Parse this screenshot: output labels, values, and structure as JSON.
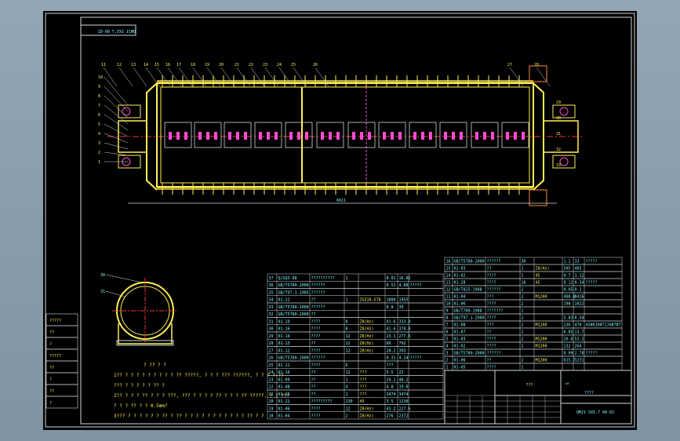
{
  "drawing": {
    "code": "QMJ1 SX5.7 00-02",
    "code_mirrored": "QMJ1 SX5.7 00-02",
    "title_block_label": "????",
    "title_block_cell": "???",
    "overall_dim": "6611"
  },
  "left_strip": [
    "?????",
    "??",
    "?",
    "?????",
    "??",
    "?",
    "??",
    "?"
  ],
  "notes": {
    "heading": "? ?? ? ?",
    "lines": [
      "1?? ? ? ? ? ? ? ? ? ? ?? ?????, ? ? ? ??? ??????, ? ? ? ? ??",
      "??? ? ? ? ? ? ?? ?",
      "2?? ? ? ? ?? ? ? ? ???, ??? ? ? ? ? ?? ? ? ? ?? ?????, ? ? ???",
      "? ? ? ?? ? ? 0.5mm?",
      "3??? ? ? ? ? ? ? ?? ? ?? ? ? ? ? ? ? ? ? ? ? ? ?? ? ?"
    ]
  },
  "parts_left": [
    [
      "37",
      "Q/GQ3-08",
      "??????????",
      "2",
      "",
      "8.01",
      "16.02",
      ""
    ],
    [
      "36",
      "GB/T5780-2000",
      "??????",
      "",
      "",
      "0.51",
      "4.80",
      "?????"
    ],
    [
      "35",
      "GB/T97.1-1985",
      "??????",
      "",
      "",
      "",
      "",
      ""
    ],
    [
      "34",
      "01-22",
      "??",
      "1",
      "ZG310-570",
      "1800",
      "1955",
      ""
    ],
    [
      "33",
      "GB/T5780-2000",
      "??????",
      "",
      "",
      "0.8",
      "39",
      ""
    ],
    [
      "32",
      "GB/T5780-2000",
      "??",
      "",
      "",
      "",
      "",
      ""
    ],
    [
      "31",
      "01-19",
      "????",
      "8",
      "Z8(Hz)",
      "41.6",
      "333.8",
      ""
    ],
    [
      "30",
      "01-16",
      "????",
      "8",
      "Z8(Hz)",
      "41.6",
      "378.8",
      ""
    ],
    [
      "29",
      "01-14",
      "????",
      "12",
      "Z8(Hz)",
      "23.1",
      "277.6",
      ""
    ],
    [
      "28",
      "01-13",
      "??",
      "12",
      "Z8(Hz)",
      "66",
      "792",
      ""
    ],
    [
      "27",
      "01-12",
      "????",
      "12",
      "Z8(Hz)",
      "28.2",
      "393",
      ""
    ],
    [
      "26",
      "GB/T5780-2000",
      "??????",
      "",
      "",
      "0.31",
      "4.24",
      "?????"
    ],
    [
      "25",
      "01-11",
      "????",
      "6",
      "",
      "???",
      "",
      ""
    ],
    [
      "24",
      "01-10",
      "??",
      "12",
      "???",
      "5.5",
      "22",
      ""
    ],
    [
      "23",
      "01-09",
      "??",
      "1",
      "???",
      "24.1",
      "48.2",
      ""
    ],
    [
      "22",
      "01-08",
      "??",
      "4",
      "???",
      "4.8",
      "19.6",
      ""
    ],
    [
      "21",
      "01-15",
      "??",
      "1",
      "???",
      "3474",
      "3474",
      ""
    ],
    [
      "20",
      "01-22",
      "?????????",
      "230",
      "45",
      "3.5",
      "1230",
      ""
    ],
    [
      "19",
      "01-06",
      "????",
      "12",
      "Z8(Hz)",
      "43.2",
      "227.6",
      ""
    ],
    [
      "18",
      "01-04",
      "????",
      "2",
      "Z8(Hz)",
      "276",
      "2372",
      ""
    ]
  ],
  "parts_right": [
    [
      "16",
      "GB/T5780-2000",
      "??????",
      "30",
      "",
      "1.1",
      "33",
      "?????"
    ],
    [
      "15",
      "01-03",
      "??",
      "1",
      "Z8(Hz)",
      "505",
      "465",
      ""
    ],
    [
      "14",
      "01-02",
      "????",
      "1",
      "45",
      "0.7",
      "1.12",
      ""
    ],
    [
      "13",
      "01-28",
      "????",
      "16",
      "45",
      "0.12",
      "0.34",
      "?????"
    ],
    [
      "12",
      "GB/T825-1988",
      "??????",
      "2",
      "",
      "0.05",
      "0.1",
      ""
    ],
    [
      "11",
      "01-04",
      "???",
      "2",
      "M1200",
      "408.8",
      "8416",
      ""
    ],
    [
      "10",
      "01-06",
      "????",
      "2",
      "",
      "198",
      "1022",
      ""
    ],
    [
      "9",
      "GB/T700-1988",
      "???????",
      "2",
      "",
      "",
      "",
      ""
    ],
    [
      "8",
      "GB/T97.1-2000",
      "????",
      "2",
      "",
      "5.83",
      "0.54",
      ""
    ],
    [
      "7",
      "01-08",
      "???",
      "2",
      "M1200",
      "236",
      "470",
      "45#0J0#T2J0#7#7"
    ],
    [
      "6",
      "01-07",
      "??",
      "2",
      "",
      "6.85",
      "13.7",
      ""
    ],
    [
      "5",
      "01-03",
      "????",
      "2",
      "M1200",
      "26.6",
      "53.2",
      ""
    ],
    [
      "4",
      "01-02",
      "????",
      "2",
      "M1200",
      "132",
      "264",
      ""
    ],
    [
      "3",
      "GB/T5780-2000",
      "??????",
      "",
      "",
      "0.09",
      "2.78",
      "?????"
    ],
    [
      "2",
      "01-06",
      "??",
      "2",
      "M1200",
      "615.7",
      "1231",
      ""
    ],
    [
      "1",
      "01-05",
      "????",
      "1",
      "",
      "",
      "",
      ""
    ]
  ],
  "balloons_top": [
    "11",
    "12",
    "13",
    "14",
    "15",
    "16",
    "17",
    "18",
    "19",
    "20",
    "21",
    "22",
    "23",
    "24",
    "25",
    "26",
    "27",
    "28"
  ],
  "balloons_left": [
    "10",
    "9",
    "8",
    "7",
    "6",
    "5",
    "4",
    "3",
    "2",
    "1"
  ],
  "balloons_right": [
    "29",
    "30",
    "31",
    "32",
    "33"
  ],
  "section_labels": [
    "30",
    "31"
  ]
}
